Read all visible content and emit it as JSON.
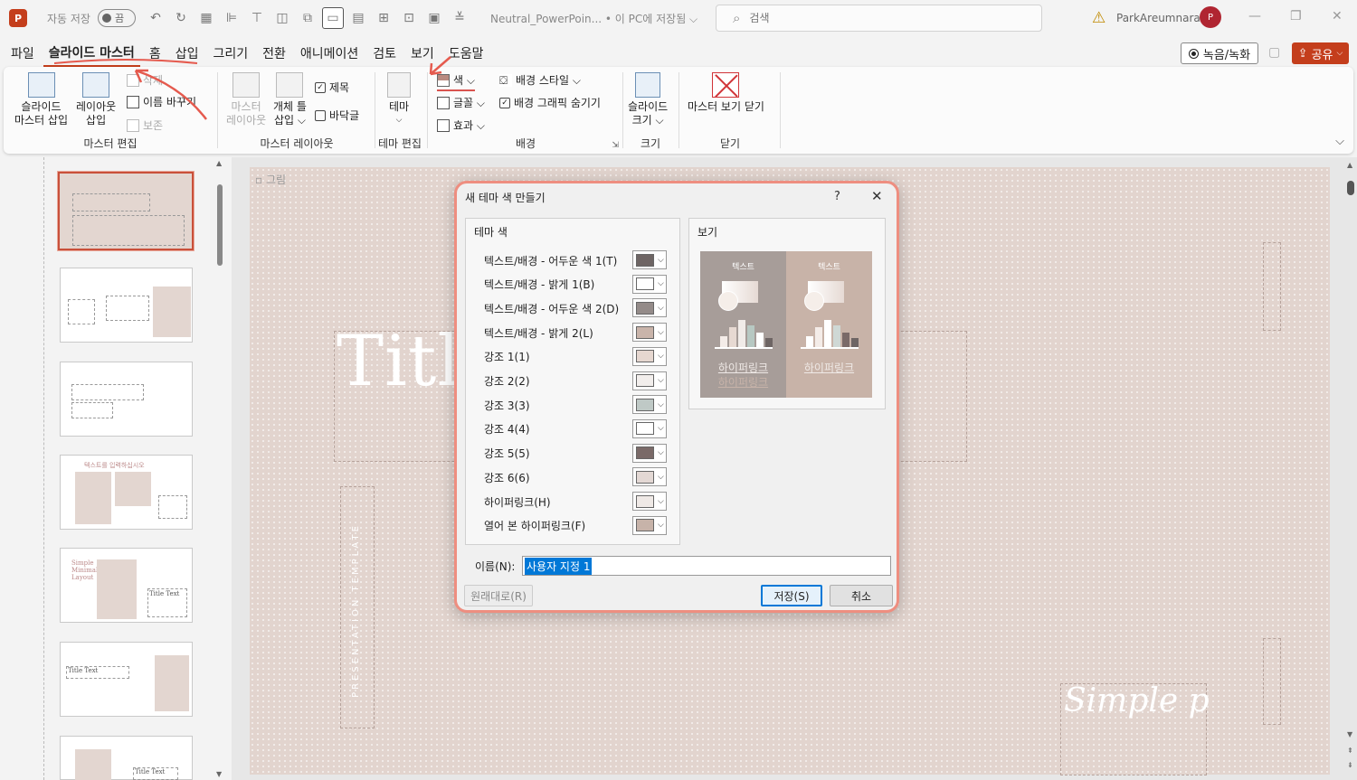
{
  "titlebar": {
    "app_icon": "P",
    "autosave_label": "자동 저장",
    "autosave_state": "끔",
    "doc_title": "Neutral_PowerPoin... • 이 PC에 저장됨 ⌵",
    "search_placeholder": "검색",
    "user_name": "ParkAreumnara",
    "avatar_initial": "P"
  },
  "menu": {
    "tabs": [
      "파일",
      "슬라이드 마스터",
      "홈",
      "삽입",
      "그리기",
      "전환",
      "애니메이션",
      "검토",
      "보기",
      "도움말"
    ],
    "active_tab": "슬라이드 마스터",
    "record_label": "녹음/녹화",
    "share_label": "공유"
  },
  "ribbon": {
    "groups": {
      "edit_master": "마스터 편집",
      "master_layout": "마스터 레이아웃",
      "edit_theme": "테마 편집",
      "background": "배경",
      "size": "크기",
      "close": "닫기"
    },
    "insert_master_l1": "슬라이드",
    "insert_master_l2": "마스터 삽입",
    "insert_layout_l1": "레이아웃",
    "insert_layout_l2": "삽입",
    "delete_label": "삭제",
    "rename_label": "이름 바꾸기",
    "preserve_label": "보존",
    "master_layout_l1": "마스터",
    "master_layout_l2": "레이아웃",
    "insert_placeholder_l1": "개체 틀",
    "insert_placeholder_l2": "삽입 ⌵",
    "title_check": "제목",
    "footer_check": "바닥글",
    "theme_label": "테마",
    "colors_label": "색 ⌵",
    "fonts_label": "글꼴 ⌵",
    "effects_label": "효과 ⌵",
    "bg_styles_label": "배경 스타일 ⌵",
    "hide_bg_label": "배경 그래픽 숨기기",
    "slide_size_l1": "슬라이드",
    "slide_size_l2": "크기 ⌵",
    "close_master_label": "마스터 보기 닫기"
  },
  "slide": {
    "tag": "▫ 그림",
    "title_text": "Titl",
    "vertical_text": "PRESENTATION TEMPLATE",
    "script_text": "Simple p"
  },
  "thumbnails": {
    "thumb4_text": "텍스트를 입력하십시오",
    "thumb5_text": "Simple Minimal Layout",
    "title_text": "Title Text"
  },
  "dialog": {
    "title": "새 테마 색 만들기",
    "help": "?",
    "close": "✕",
    "theme_colors_legend": "테마 색",
    "preview_legend": "보기",
    "rows": [
      {
        "label": "텍스트/배경 - 어두운 색 1(T)",
        "color": "#6e6564"
      },
      {
        "label": "텍스트/배경 - 밝게 1(B)",
        "color": "#ffffff"
      },
      {
        "label": "텍스트/배경 - 어두운 색 2(D)",
        "color": "#948b89"
      },
      {
        "label": "텍스트/배경 - 밝게 2(L)",
        "color": "#c9b4aa"
      },
      {
        "label": "강조 1(1)",
        "color": "#e6d7d0"
      },
      {
        "label": "강조 2(2)",
        "color": "#f2eeec"
      },
      {
        "label": "강조 3(3)",
        "color": "#bfc9c6"
      },
      {
        "label": "강조 4(4)",
        "color": "#ffffff"
      },
      {
        "label": "강조 5(5)",
        "color": "#7a6a68"
      },
      {
        "label": "강조 6(6)",
        "color": "#e3d8d4"
      },
      {
        "label": "하이퍼링크(H)",
        "color": "#efe9e6"
      },
      {
        "label": "열어 본 하이퍼링크(F)",
        "color": "#c7b3a9"
      }
    ],
    "preview": {
      "text_label": "텍스트",
      "hyperlink_label": "하이퍼링크",
      "dark_bg": "#a79d99",
      "light_bg": "#c8b3a8"
    },
    "name_label": "이름(N):",
    "name_value": "사용자 지정 1",
    "reset_label": "원래대로(R)",
    "save_label": "저장(S)",
    "cancel_label": "취소"
  }
}
